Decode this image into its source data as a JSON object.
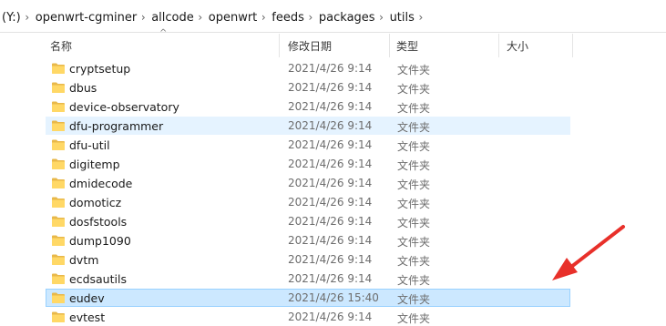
{
  "breadcrumb": {
    "drive": "(Y:)",
    "items": [
      "openwrt-cgminer",
      "allcode",
      "openwrt",
      "feeds",
      "packages",
      "utils"
    ],
    "separator": "›"
  },
  "columns": {
    "name": "名称",
    "date": "修改日期",
    "type": "类型",
    "size": "大小",
    "sort_indicator": "^"
  },
  "files": [
    {
      "name": "cryptsetup",
      "date": "2021/4/26 9:14",
      "type": "文件夹",
      "state": "normal"
    },
    {
      "name": "dbus",
      "date": "2021/4/26 9:14",
      "type": "文件夹",
      "state": "normal"
    },
    {
      "name": "device-observatory",
      "date": "2021/4/26 9:14",
      "type": "文件夹",
      "state": "normal"
    },
    {
      "name": "dfu-programmer",
      "date": "2021/4/26 9:14",
      "type": "文件夹",
      "state": "hover"
    },
    {
      "name": "dfu-util",
      "date": "2021/4/26 9:14",
      "type": "文件夹",
      "state": "normal"
    },
    {
      "name": "digitemp",
      "date": "2021/4/26 9:14",
      "type": "文件夹",
      "state": "normal"
    },
    {
      "name": "dmidecode",
      "date": "2021/4/26 9:14",
      "type": "文件夹",
      "state": "normal"
    },
    {
      "name": "domoticz",
      "date": "2021/4/26 9:14",
      "type": "文件夹",
      "state": "normal"
    },
    {
      "name": "dosfstools",
      "date": "2021/4/26 9:14",
      "type": "文件夹",
      "state": "normal"
    },
    {
      "name": "dump1090",
      "date": "2021/4/26 9:14",
      "type": "文件夹",
      "state": "normal"
    },
    {
      "name": "dvtm",
      "date": "2021/4/26 9:14",
      "type": "文件夹",
      "state": "normal"
    },
    {
      "name": "ecdsautils",
      "date": "2021/4/26 9:14",
      "type": "文件夹",
      "state": "normal"
    },
    {
      "name": "eudev",
      "date": "2021/4/26 15:40",
      "type": "文件夹",
      "state": "selected"
    },
    {
      "name": "evtest",
      "date": "2021/4/26 9:14",
      "type": "文件夹",
      "state": "normal"
    }
  ],
  "colors": {
    "hover": "#e5f3ff",
    "selected": "#cce8ff",
    "selected_border": "#99d1ff",
    "folder": "#ffd866",
    "annotation_arrow": "#e8302a"
  },
  "annotation": {
    "icon": "red-arrow-icon",
    "points_to": "eudev"
  }
}
